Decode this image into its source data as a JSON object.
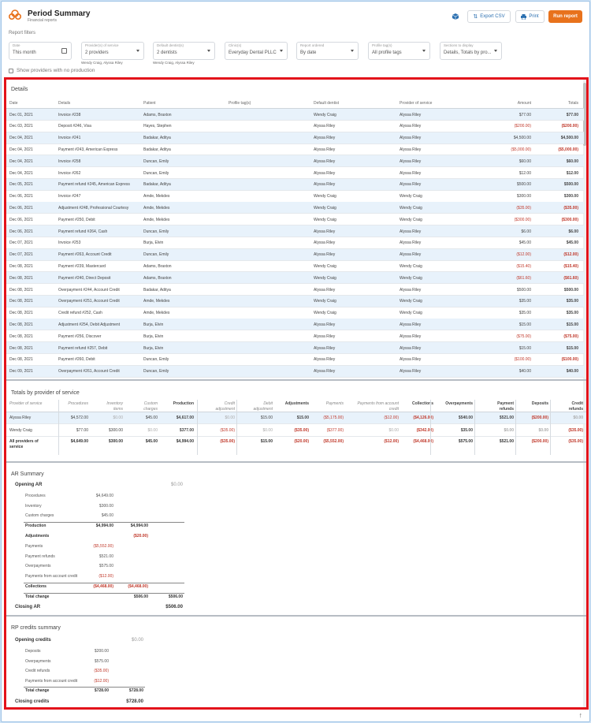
{
  "header": {
    "title": "Period Summary",
    "subtitle": "Financial reports",
    "export_label": "Export CSV",
    "print_label": "Print",
    "run_label": "Run report"
  },
  "filters": {
    "section_label": "Report filters",
    "items": [
      {
        "label": "Date",
        "value": "This month",
        "sub": ""
      },
      {
        "label": "Provider(s) of service",
        "value": "2 providers",
        "sub": "Wendy Craig, Alyssa Riley"
      },
      {
        "label": "Default dentist(s)",
        "value": "2 dentists",
        "sub": "Wendy Craig, Alyssa Riley"
      },
      {
        "label": "Clinic(s)",
        "value": "Everyday Dental PLLC",
        "sub": ""
      },
      {
        "label": "Report ordered",
        "value": "By date",
        "sub": ""
      },
      {
        "label": "Profile tag(s)",
        "value": "All profile tags",
        "sub": ""
      },
      {
        "label": "Sections to display",
        "value": "Details, Totals by pro...",
        "sub": ""
      }
    ],
    "show_no_production": "Show providers with no production"
  },
  "details": {
    "title": "Details",
    "columns": [
      "Date",
      "Details",
      "Patient",
      "Profile tag(s)",
      "Default dentist",
      "Provider of service",
      "Amount",
      "Totals"
    ],
    "rows": [
      [
        "Dec 01, 2021",
        "Invoice #238",
        "Adams, Braxton",
        "",
        "Wendy Craig",
        "Alyssa Riley",
        "$77.00",
        "$77.00"
      ],
      [
        "Dec 03, 2021",
        "Deposit #246, Visa",
        "Hayes, Stephen",
        "",
        "Alyssa Riley",
        "Alyssa Riley",
        "($200.00)",
        "($200.00)"
      ],
      [
        "Dec 04, 2021",
        "Invoice #241",
        "Badakar, Aditya",
        "",
        "Alyssa Riley",
        "Alyssa Riley",
        "$4,500.00",
        "$4,500.00"
      ],
      [
        "Dec 04, 2021",
        "Payment #243, American Express",
        "Badakar, Aditya",
        "",
        "Alyssa Riley",
        "Alyssa Riley",
        "($5,000.00)",
        "($5,000.00)"
      ],
      [
        "Dec 04, 2021",
        "Invoice #258",
        "Duncan, Emily",
        "",
        "Alyssa Riley",
        "Alyssa Riley",
        "$60.00",
        "$60.00"
      ],
      [
        "Dec 04, 2021",
        "Invoice #262",
        "Duncan, Emily",
        "",
        "Alyssa Riley",
        "Alyssa Riley",
        "$12.00",
        "$12.00"
      ],
      [
        "Dec 05, 2021",
        "Payment refund #245, American Express",
        "Badakar, Aditya",
        "",
        "Alyssa Riley",
        "Alyssa Riley",
        "$500.00",
        "$500.00"
      ],
      [
        "Dec 06, 2021",
        "Invoice #247",
        "Amde, Mekdes",
        "",
        "Wendy Craig",
        "Wendy Craig",
        "$300.00",
        "$300.00"
      ],
      [
        "Dec 06, 2021",
        "Adjustment #248, Professional Courtesy",
        "Amde, Mekdes",
        "",
        "Wendy Craig",
        "Wendy Craig",
        "($35.00)",
        "($35.00)"
      ],
      [
        "Dec 06, 2021",
        "Payment #250, Debit",
        "Amde, Mekdes",
        "",
        "Wendy Craig",
        "Wendy Craig",
        "($300.00)",
        "($300.00)"
      ],
      [
        "Dec 06, 2021",
        "Payment refund #264, Cash",
        "Duncan, Emily",
        "",
        "Alyssa Riley",
        "Alyssa Riley",
        "$6.00",
        "$6.00"
      ],
      [
        "Dec 07, 2021",
        "Invoice #253",
        "Burja, Elvin",
        "",
        "Alyssa Riley",
        "Alyssa Riley",
        "$45.00",
        "$45.00"
      ],
      [
        "Dec 07, 2021",
        "Payment #263, Account Credit",
        "Duncan, Emily",
        "",
        "Alyssa Riley",
        "Alyssa Riley",
        "($12.00)",
        "($12.00)"
      ],
      [
        "Dec 08, 2021",
        "Payment #239, Mastercard",
        "Adams, Braxton",
        "",
        "Wendy Craig",
        "Wendy Craig",
        "($15.40)",
        "($15.40)"
      ],
      [
        "Dec 08, 2021",
        "Payment #240, Direct Deposit",
        "Adams, Braxton",
        "",
        "Wendy Craig",
        "Wendy Craig",
        "($61.60)",
        "($61.60)"
      ],
      [
        "Dec 08, 2021",
        "Overpayment #244, Account Credit",
        "Badakar, Aditya",
        "",
        "Alyssa Riley",
        "Alyssa Riley",
        "$500.00",
        "$500.00"
      ],
      [
        "Dec 08, 2021",
        "Overpayment #251, Account Credit",
        "Amde, Mekdes",
        "",
        "Wendy Craig",
        "Wendy Craig",
        "$35.00",
        "$35.00"
      ],
      [
        "Dec 08, 2021",
        "Credit refund #252, Cash",
        "Amde, Mekdes",
        "",
        "Wendy Craig",
        "Wendy Craig",
        "$35.00",
        "$35.00"
      ],
      [
        "Dec 08, 2021",
        "Adjustment #254, Debit Adjustment",
        "Burja, Elvin",
        "",
        "Alyssa Riley",
        "Alyssa Riley",
        "$15.00",
        "$15.00"
      ],
      [
        "Dec 08, 2021",
        "Payment #256, Discover",
        "Burja, Elvin",
        "",
        "Alyssa Riley",
        "Alyssa Riley",
        "($75.00)",
        "($75.00)"
      ],
      [
        "Dec 08, 2021",
        "Payment refund #257, Debit",
        "Burja, Elvin",
        "",
        "Alyssa Riley",
        "Alyssa Riley",
        "$15.00",
        "$15.00"
      ],
      [
        "Dec 08, 2021",
        "Payment #260, Debit",
        "Duncan, Emily",
        "",
        "Alyssa Riley",
        "Alyssa Riley",
        "($100.00)",
        "($100.00)"
      ],
      [
        "Dec 09, 2021",
        "Overpayment #261, Account Credit",
        "Duncan, Emily",
        "",
        "Alyssa Riley",
        "Alyssa Riley",
        "$40.00",
        "$40.00"
      ]
    ]
  },
  "providers": {
    "title": "Totals by provider of service",
    "columns": [
      {
        "line1": "Provider of service",
        "line2": ""
      },
      {
        "line1": "Procedures",
        "line2": ""
      },
      {
        "line1": "Inventory",
        "line2": "items"
      },
      {
        "line1": "Custom",
        "line2": "charges"
      },
      {
        "line1": "Production",
        "line2": ""
      },
      {
        "line1": "Credit",
        "line2": "adjustment"
      },
      {
        "line1": "Debit",
        "line2": "adjustment"
      },
      {
        "line1": "Adjustments",
        "line2": ""
      },
      {
        "line1": "Payments",
        "line2": ""
      },
      {
        "line1": "Payments from account",
        "line2": "credit"
      },
      {
        "line1": "Collections",
        "line2": ""
      },
      {
        "line1": "Overpayments",
        "line2": ""
      },
      {
        "line1": "Payment",
        "line2": "refunds"
      },
      {
        "line1": "Deposits",
        "line2": ""
      },
      {
        "line1": "Credit",
        "line2": "refunds"
      }
    ],
    "rows": [
      {
        "name": "Alyssa Riley",
        "values": [
          "$4,572.00",
          "$0.00",
          "$45.00",
          "$4,617.00",
          "$0.00",
          "$15.00",
          "$15.00",
          "($5,175.00)",
          "($12.00)",
          "($4,126.00)",
          "$540.00",
          "$521.00",
          "($200.00)",
          "$0.00"
        ]
      },
      {
        "name": "Wendy Craig",
        "values": [
          "$77.00",
          "$300.00",
          "$0.00",
          "$377.00",
          "($35.00)",
          "$0.00",
          "($35.00)",
          "($377.00)",
          "$0.00",
          "($342.00)",
          "$35.00",
          "$0.00",
          "$0.00",
          "($35.00)"
        ]
      }
    ],
    "total": {
      "name_line1": "All providers of",
      "name_line2": "service",
      "values": [
        "$4,649.00",
        "$300.00",
        "$45.00",
        "$4,994.00",
        "($35.00)",
        "$15.00",
        "($20.00)",
        "($5,552.00)",
        "($12.00)",
        "($4,468.00)",
        "$575.00",
        "$521.00",
        "($200.00)",
        "($35.00)"
      ]
    }
  },
  "ar": {
    "title": "AR Summary",
    "opening_label": "Opening AR",
    "opening_value": "$0.00",
    "lines": [
      {
        "label": "Procedures",
        "c1": "$4,649.00",
        "c2": "",
        "c3": "",
        "type": "item"
      },
      {
        "label": "Inventory",
        "c1": "$300.00",
        "c2": "",
        "c3": "",
        "type": "item"
      },
      {
        "label": "Custom charges",
        "c1": "$45.00",
        "c2": "",
        "c3": "",
        "type": "item"
      },
      {
        "label": "Production",
        "c1": "$4,994.00",
        "c2": "$4,994.00",
        "c3": "",
        "type": "sub"
      },
      {
        "label": "Adjustments",
        "c1": "",
        "c2": "($20.00)",
        "c3": "",
        "type": "sub"
      },
      {
        "label": "Payments",
        "c1": "($5,552.00)",
        "c2": "",
        "c3": "",
        "type": "item"
      },
      {
        "label": "Payment refunds",
        "c1": "$521.00",
        "c2": "",
        "c3": "",
        "type": "item"
      },
      {
        "label": "Overpayments",
        "c1": "$575.00",
        "c2": "",
        "c3": "",
        "type": "item"
      },
      {
        "label": "Payments from account credit",
        "c1": "($12.00)",
        "c2": "",
        "c3": "",
        "type": "item"
      },
      {
        "label": "Collections",
        "c1": "($4,468.00)",
        "c2": "($4,468.00)",
        "c3": "",
        "type": "sub"
      },
      {
        "label": "Total change",
        "c1": "",
        "c2": "$506.00",
        "c3": "$506.00",
        "type": "total"
      }
    ],
    "closing_label": "Closing AR",
    "closing_value": "$506.00"
  },
  "rp": {
    "title": "RP credits summary",
    "opening_label": "Opening credits",
    "opening_value": "$0.00",
    "lines": [
      {
        "label": "Deposits",
        "c1": "$200.00",
        "c2": ""
      },
      {
        "label": "Overpayments",
        "c1": "$575.00",
        "c2": ""
      },
      {
        "label": "Credit refunds",
        "c1": "($35.00)",
        "c2": ""
      },
      {
        "label": "Payments from account credit",
        "c1": "($12.00)",
        "c2": ""
      },
      {
        "label": "Total change",
        "c1": "$728.00",
        "c2": "$728.00"
      }
    ],
    "closing_label": "Closing credits",
    "closing_value": "$728.00"
  },
  "colors": {
    "accent": "#e8721c",
    "link": "#2a6fb0",
    "negative": "#c0392b",
    "highlight_row": "#e8f2fb",
    "red_frame": "#e3131b"
  }
}
